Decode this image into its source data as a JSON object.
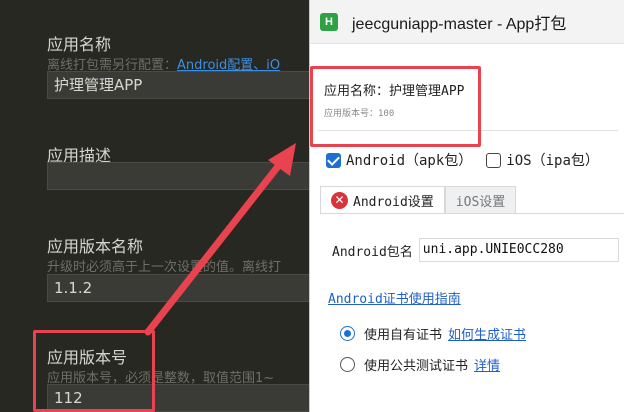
{
  "editor": {
    "fields": [
      {
        "title": "应用名称",
        "hint_text": "离线打包需另行配置：",
        "hint_link": "Android配置",
        "hint_link2": "、iO",
        "value": "护理管理APP"
      },
      {
        "title": "应用描述",
        "value": ""
      },
      {
        "title": "应用版本名称",
        "hint_text": "升级时必须高于上一次设置的值。离线打",
        "value": "1.1.2"
      },
      {
        "title": "应用版本号",
        "hint_text": "应用版本号，必须是整数，取值范围1~",
        "value": "112"
      }
    ]
  },
  "annotation": {
    "color": "#e8434f"
  },
  "dialog": {
    "icon_letter": "H",
    "title": "jeecguniapp-master - App打包",
    "app_name_line": "应用名称：护理管理APP",
    "app_version_line": "应用版本号：100",
    "platforms": [
      {
        "label": "Android（apk包）",
        "checked": true
      },
      {
        "label": "iOS（ipa包）",
        "checked": false
      }
    ],
    "tabs": [
      {
        "label": "Android设置",
        "active": true,
        "icon": "error-icon"
      },
      {
        "label": "iOS设置",
        "active": false
      }
    ],
    "package_label": "Android包名",
    "package_value": "uni.app.UNIE0CC280",
    "cert_guide_link": "Android证书使用指南",
    "cert_options": [
      {
        "label": "使用自有证书",
        "link": "如何生成证书",
        "selected": true
      },
      {
        "label": "使用公共测试证书",
        "link": "详情",
        "selected": false
      }
    ]
  }
}
